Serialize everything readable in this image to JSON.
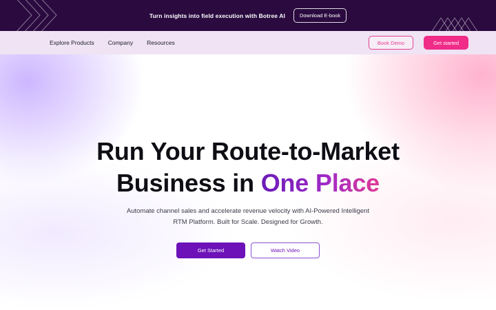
{
  "announcement": {
    "text": "Turn insights into field execution with Botree AI",
    "button_label": "Download E-book"
  },
  "nav": {
    "links": [
      {
        "label": "Explore Products"
      },
      {
        "label": "Company"
      },
      {
        "label": "Resources"
      }
    ],
    "book_demo_label": "Book Demo",
    "get_started_label": "Get started"
  },
  "hero": {
    "headline_line1": "Run Your Route-to-Market",
    "headline_line2_prefix": "Business in",
    "headline_line2_accent": "One Place",
    "subtext_line1": "Automate channel sales and accelerate revenue velocity with AI-Powered Intelligent",
    "subtext_line2": "RTM Platform. Built for Scale. Designed for Growth.",
    "primary_button": "Get Started",
    "secondary_button": "Watch Video"
  },
  "colors": {
    "announcement_bg": "#2a0a3f",
    "nav_bg": "#efe3f4",
    "brand_pink": "#f02b88",
    "brand_purple": "#6c12b8"
  }
}
